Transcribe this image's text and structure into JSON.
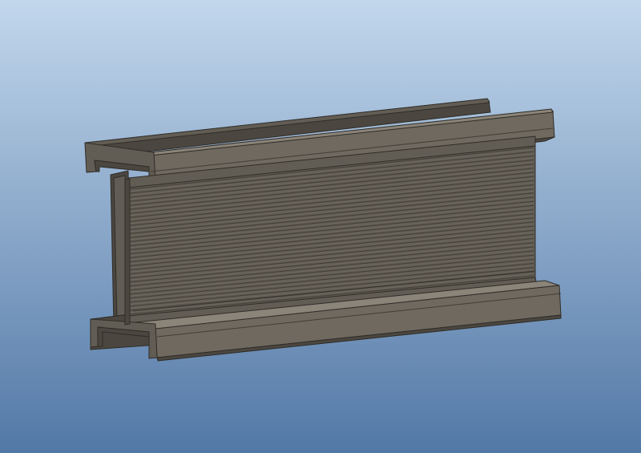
{
  "scene": {
    "subject": "extruded-aluminum-profile",
    "view": "3d-model-viewport",
    "background": {
      "top_color": "#c2d7ec",
      "bottom_color": "#5278a6"
    },
    "model_colors": {
      "face_light": "#6f695f",
      "face_mid": "#625d54",
      "face_dark": "#4b4740",
      "edge": "#2f2c27",
      "highlight": "#8a8479",
      "groove": "#3c3933"
    }
  }
}
